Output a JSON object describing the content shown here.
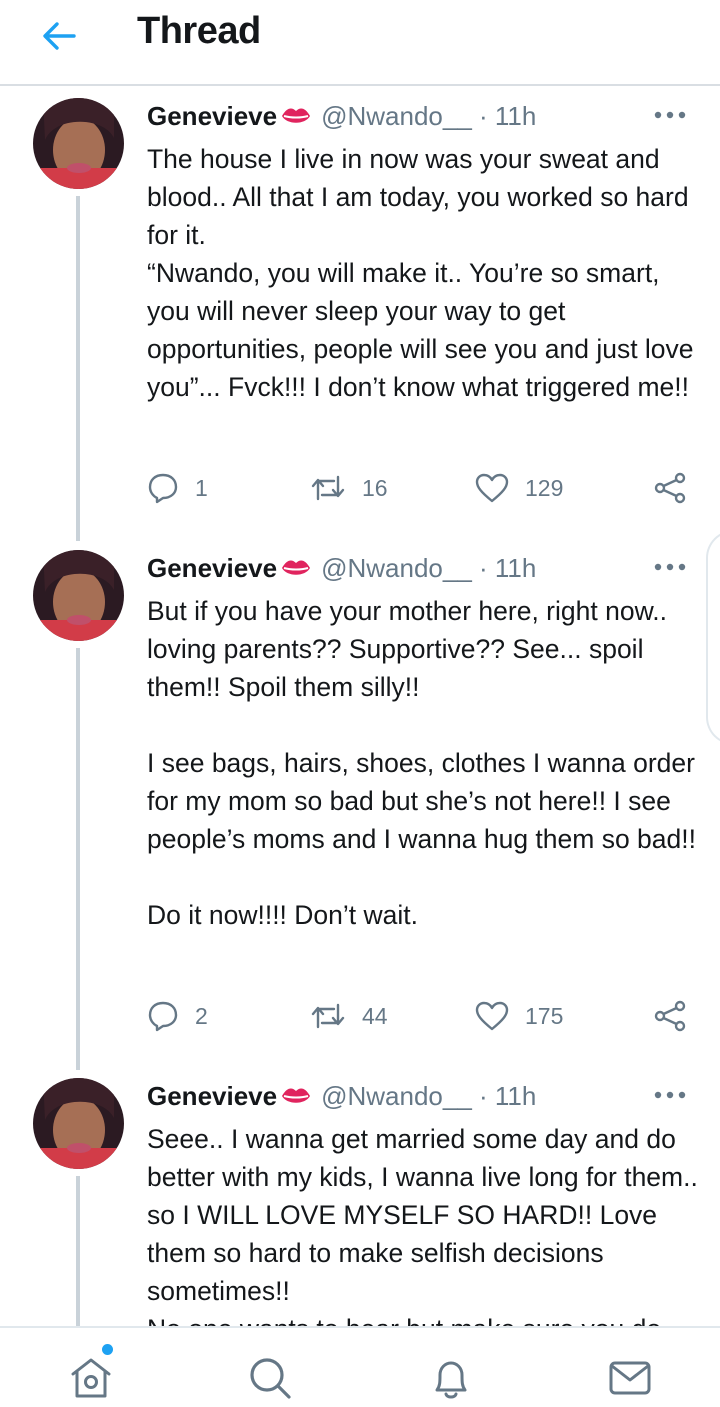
{
  "header": {
    "title": "Thread"
  },
  "tweets": [
    {
      "name": "Genevieve",
      "handle_time": "@Nwando__ · 11h",
      "text": "The house I live in now was your sweat and blood.. All that I am today, you worked so hard for it.\n“Nwando, you will make it.. You’re so smart, you will never sleep your way to get opportunities, people will see you and just love you”... Fvck!!! I don’t know what triggered me!!",
      "replies": "1",
      "retweets": "16",
      "likes": "129"
    },
    {
      "name": "Genevieve",
      "handle_time": "@Nwando__ · 11h",
      "text": "But if you have your mother here, right now.. loving parents?? Supportive?? See... spoil them!! Spoil them silly!!\n\nI see bags, hairs, shoes, clothes I wanna order for my mom so bad but she’s not here!! I see people’s moms and I wanna hug them so bad!!\n\nDo it now!!!! Don’t wait.",
      "replies": "2",
      "retweets": "44",
      "likes": "175"
    },
    {
      "name": "Genevieve",
      "handle_time": "@Nwando__ · 11h",
      "text": "Seee.. I wanna get married some day and do better with my kids, I wanna live long for them.. so I WILL LOVE MYSELF SO HARD!! Love them so hard to make selfish decisions sometimes!!\nNo one wants to hear but make sure you do what you must do for yourself!!",
      "replies": "",
      "retweets": "",
      "likes": ""
    }
  ],
  "colors": {
    "accent": "#1da1f2",
    "text": "#14171a",
    "muted": "#657786",
    "thread_line": "#c9d2d9",
    "emoji_red": "#e0245e"
  },
  "icons": {
    "back": "arrow-left-icon",
    "more": "more-dots-icon",
    "reply": "reply-bubble-icon",
    "retweet": "retweet-icon",
    "like": "heart-icon",
    "share": "share-icon",
    "nav_home": "home-icon",
    "nav_search": "search-icon",
    "nav_notifications": "bell-icon",
    "nav_messages": "mail-icon"
  }
}
